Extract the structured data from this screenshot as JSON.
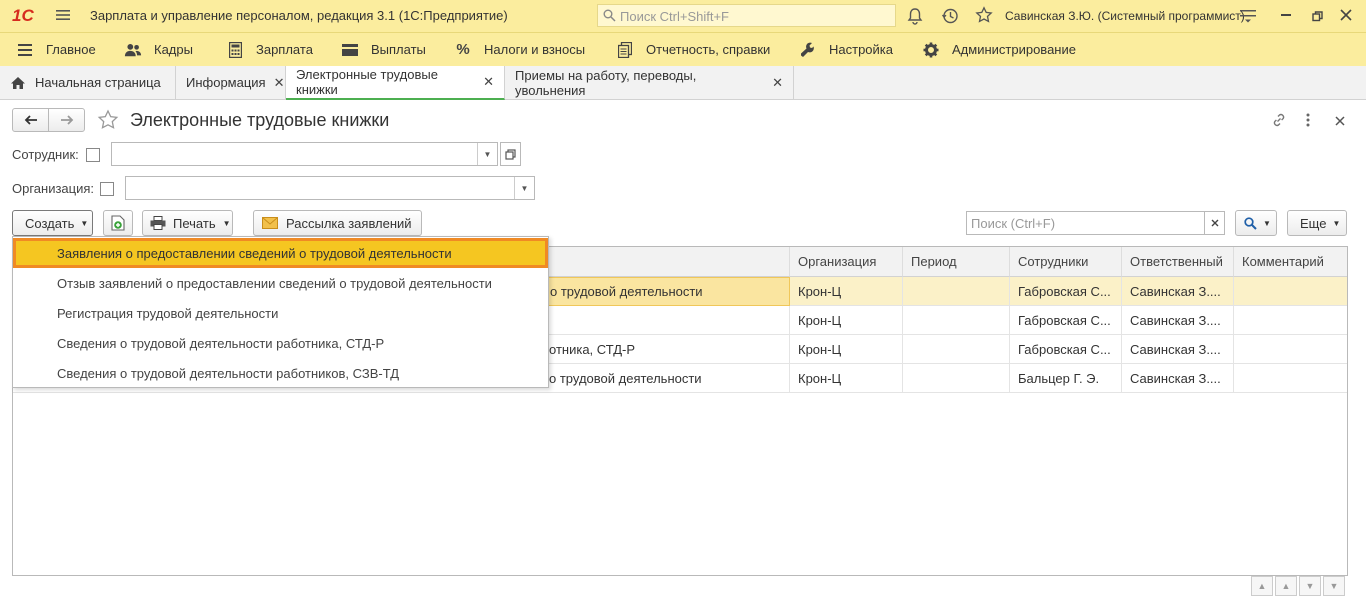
{
  "titlebar": {
    "logo": "1С",
    "app_title": "Зарплата и управление персоналом, редакция 3.1  (1С:Предприятие)",
    "search_placeholder": "Поиск Ctrl+Shift+F",
    "user": "Савинская З.Ю. (Системный программист)"
  },
  "menu": [
    {
      "label": "Главное",
      "icon": "hamburger-icon"
    },
    {
      "label": "Кадры",
      "icon": "people-icon"
    },
    {
      "label": "Зарплата",
      "icon": "calculator-icon"
    },
    {
      "label": "Выплаты",
      "icon": "wallet-icon"
    },
    {
      "label": "Налоги и взносы",
      "icon": "percent-icon"
    },
    {
      "label": "Отчетность, справки",
      "icon": "reports-icon"
    },
    {
      "label": "Настройка",
      "icon": "wrench-icon"
    },
    {
      "label": "Администрирование",
      "icon": "gear-icon"
    }
  ],
  "tabs": [
    {
      "label": "Начальная страница"
    },
    {
      "label": "Информация"
    },
    {
      "label": "Электронные трудовые книжки"
    },
    {
      "label": "Приемы на работу, переводы, увольнения"
    }
  ],
  "form": {
    "title": "Электронные трудовые книжки",
    "employee_label": "Сотрудник:",
    "employee_value": "",
    "org_label": "Организация:",
    "org_value": ""
  },
  "toolbar": {
    "create_label": "Создать",
    "print_label": "Печать",
    "mailing_label": "Рассылка заявлений",
    "search_placeholder": "Поиск (Ctrl+F)",
    "more_label": "Еще"
  },
  "grid": {
    "columns": [
      "Организация",
      "Период",
      "Сотрудники",
      "Ответственный",
      "Комментарий"
    ],
    "rows": [
      {
        "doc": "о трудовой деятельности",
        "org": "Крон-Ц",
        "period": "",
        "employees": "Габровская С...",
        "responsible": "Савинская З....",
        "comment": ""
      },
      {
        "doc": "",
        "org": "Крон-Ц",
        "period": "",
        "employees": "Габровская С...",
        "responsible": "Савинская З....",
        "comment": ""
      },
      {
        "doc": "отника, СТД-Р",
        "org": "Крон-Ц",
        "period": "",
        "employees": "Габровская С...",
        "responsible": "Савинская З....",
        "comment": ""
      },
      {
        "doc": "о трудовой деятельности",
        "org": "Крон-Ц",
        "period": "",
        "employees": "Бальцер Г. Э.",
        "responsible": "Савинская З....",
        "comment": ""
      }
    ]
  },
  "create_menu": [
    {
      "label": "Заявления о предоставлении сведений о трудовой деятельности"
    },
    {
      "label": "Отзыв заявлений о предоставлении сведений о трудовой деятельности"
    },
    {
      "label": "Регистрация трудовой деятельности"
    },
    {
      "label": "Сведения о трудовой деятельности работника, СТД-Р"
    },
    {
      "label": "Сведения о трудовой деятельности работников, СЗВ-ТД"
    }
  ],
  "colors": {
    "accent": "#fbed9e",
    "selected": "#f5c621",
    "highlight_border": "#f08a24",
    "active_tab_line": "#4caf50"
  }
}
